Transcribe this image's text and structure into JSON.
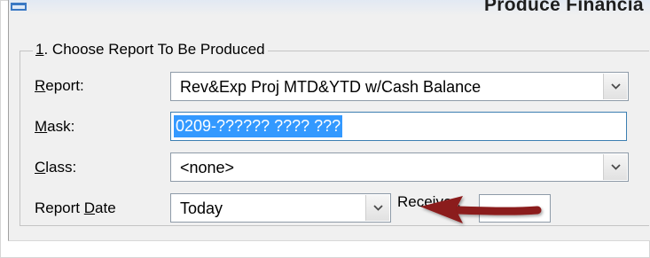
{
  "window": {
    "title": "Produce Financia"
  },
  "group": {
    "legend_key": "1",
    "legend_rest": ". Choose Report To Be Produced"
  },
  "fields": {
    "report": {
      "label_key": "R",
      "label_pre": "",
      "label_post": "eport:",
      "value": "Rev&Exp Proj MTD&YTD w/Cash Balance"
    },
    "mask": {
      "label_key": "M",
      "label_pre": "",
      "label_post": "ask:",
      "value": "0209-?????? ???? ???"
    },
    "class": {
      "label_key": "C",
      "label_pre": "",
      "label_post": "lass:",
      "value": "<none>"
    },
    "report_date": {
      "label_pre": "Report ",
      "label_key": "D",
      "label_post": "ate",
      "value": "Today"
    },
    "receiver": {
      "label": "Receiver:",
      "value": ""
    }
  },
  "annotation": {
    "arrow_color": "#8b1a1a",
    "arrow_icon": "red-arrow-icon"
  },
  "colors": {
    "selection": "#3399ff",
    "dialog_bg": "#f0f0f0",
    "focus_border": "#3c7fb1"
  }
}
